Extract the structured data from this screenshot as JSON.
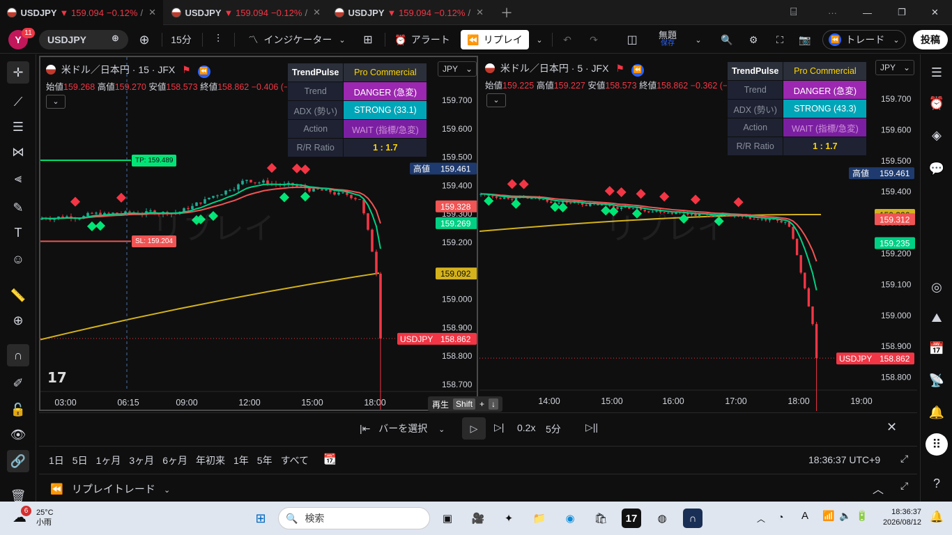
{
  "tabs": [
    {
      "symbol": "USDJPY",
      "price": "▼ 159.094",
      "change": "−0.12%",
      "slash": "/"
    },
    {
      "symbol": "USDJPY",
      "price": "▼ 159.094",
      "change": "−0.12%",
      "slash": "/"
    },
    {
      "symbol": "USDJPY",
      "price": "▼ 159.094",
      "change": "−0.12%",
      "slash": "/"
    }
  ],
  "toolbar": {
    "avatar": "Y",
    "notif": "11",
    "symbol": "USDJPY",
    "interval": "15分",
    "indicators": "インジケーター",
    "alert": "アラート",
    "replay": "リプレイ",
    "layout_name": "無題",
    "layout_status": "保存",
    "trade": "トレード",
    "publish": "投稿"
  },
  "colors": {
    "bg": "#0f0f0f",
    "up": "#22ab94",
    "down": "#f23645",
    "tp": "#00e676",
    "ema_fast": "#00d084",
    "ema_slow": "#f05454",
    "ema_long": "#d4b21c",
    "blue": "#2962ff"
  },
  "charts": [
    {
      "title": "米ドル／日本円 · 15 · JFX",
      "ohlc": {
        "o_l": "始値",
        "o": "159.268",
        "h_l": "高値",
        "h": "159.270",
        "l_l": "安値",
        "l": "158.573",
        "c_l": "終値",
        "c": "158.862",
        "chg": "−0.406 (−0.25%)"
      },
      "currency": "JPY",
      "yticks": [
        "159.700",
        "159.600",
        "159.500",
        "159.400",
        "159.300",
        "159.200",
        "159.100",
        "159.000",
        "158.900",
        "158.800",
        "158.700"
      ],
      "xticks": [
        "03:00",
        "06:15",
        "09:00",
        "12:00",
        "15:00",
        "18:00"
      ],
      "high_label": "高値",
      "high_value": "159.461",
      "price_labels": [
        {
          "text": "159.328",
          "color": "#f05454"
        },
        {
          "text": "159.269",
          "color": "#00d084"
        },
        {
          "text": "159.092",
          "color": "#d4b21c"
        }
      ],
      "last_sym": "USDJPY",
      "last_price": "158.862",
      "tp_label": "TP: 159.489",
      "sl_label": "SL: 159.204",
      "watermark": "リプレイ"
    },
    {
      "title": "米ドル／日本円 · 5 · JFX",
      "ohlc": {
        "o_l": "始値",
        "o": "159.225",
        "h_l": "高値",
        "h": "159.227",
        "l_l": "安値",
        "l": "158.573",
        "c_l": "終値",
        "c": "158.862",
        "chg": "−0.362 (−0.23%)"
      },
      "currency": "JPY",
      "yticks": [
        "159.700",
        "159.600",
        "159.500",
        "159.400",
        "159.300",
        "159.200",
        "159.100",
        "159.000",
        "158.900",
        "158.800"
      ],
      "xticks": [
        "14:00",
        "15:00",
        "16:00",
        "17:00",
        "18:00",
        "19:00"
      ],
      "high_label": "高値",
      "high_value": "159.461",
      "price_labels": [
        {
          "text": "159.326",
          "color": "#d4b21c"
        },
        {
          "text": "159.312",
          "color": "#f05454"
        },
        {
          "text": "159.235",
          "color": "#00d084"
        }
      ],
      "last_sym": "USDJPY",
      "last_price": "158.862",
      "watermark": "リプレイ"
    }
  ],
  "trendpulse": [
    {
      "header": "TrendPulse",
      "edition": "Pro Commercial",
      "rows": [
        {
          "k": "Trend",
          "v": "DANGER (急変)",
          "c": "#9c27b0",
          "tc": "#ffffff"
        },
        {
          "k": "ADX (勢い)",
          "v": "STRONG (33.1)",
          "c": "#00a6b8",
          "tc": "#ffffff"
        },
        {
          "k": "Action",
          "v": "WAIT (指標/急変)",
          "c": "#7b1fa2",
          "tc": "#ce93d8"
        },
        {
          "k": "R/R Ratio",
          "v": "1 : 1.7",
          "c": "#1e2232",
          "tc": "#ffd600"
        }
      ]
    },
    {
      "header": "TrendPulse",
      "edition": "Pro Commercial",
      "rows": [
        {
          "k": "Trend",
          "v": "DANGER (急変)",
          "c": "#9c27b0",
          "tc": "#ffffff"
        },
        {
          "k": "ADX (勢い)",
          "v": "STRONG (43.3)",
          "c": "#00a6b8",
          "tc": "#ffffff"
        },
        {
          "k": "Action",
          "v": "WAIT (指標/急変)",
          "c": "#7b1fa2",
          "tc": "#ce93d8"
        },
        {
          "k": "R/R Ratio",
          "v": "1 : 1.7",
          "c": "#1e2232",
          "tc": "#ffd600"
        }
      ]
    }
  ],
  "replay": {
    "play_tip": "再生",
    "shift": "Shift",
    "plus": "+",
    "arrow": "↓",
    "select_bar": "バーを選択",
    "speed": "0.2x",
    "interval": "5分"
  },
  "ranges": [
    "1日",
    "5日",
    "1ヶ月",
    "3ヶ月",
    "6ヶ月",
    "年初来",
    "1年",
    "5年",
    "すべて"
  ],
  "clock": "18:36:37 UTC+9",
  "bottom_panel": "リプレイトレード",
  "taskbar": {
    "temp": "25°C",
    "weather": "小雨",
    "weather_badge": "6",
    "search": "検索",
    "time": "18:36:37",
    "date": "2026/08/12",
    "ime": "A"
  }
}
